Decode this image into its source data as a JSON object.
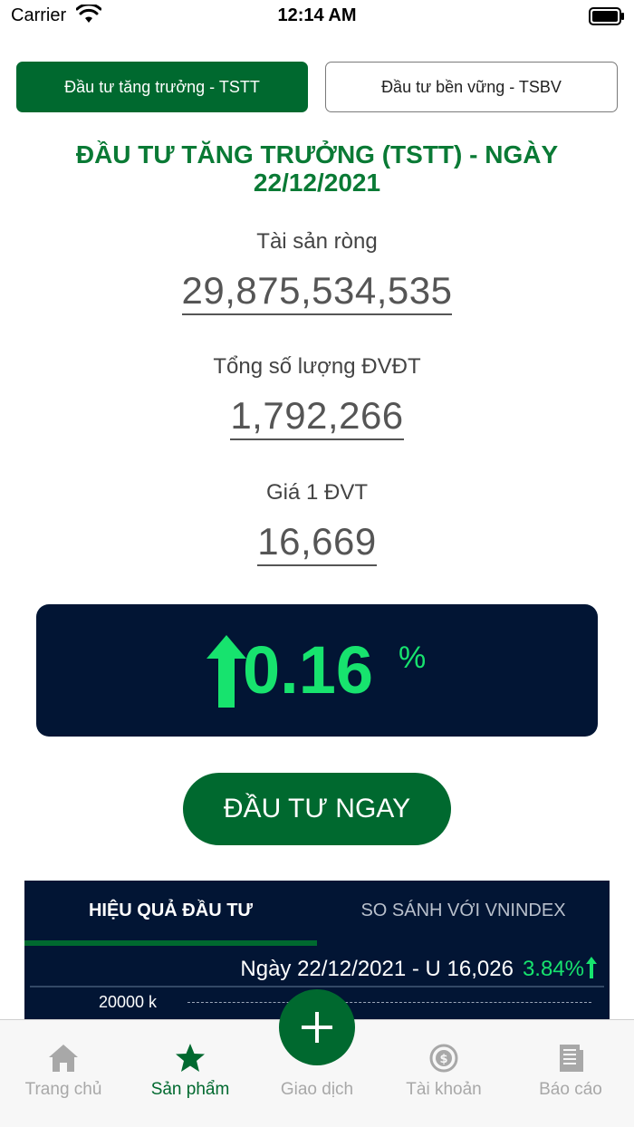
{
  "status_bar": {
    "carrier": "Carrier",
    "time": "12:14 AM"
  },
  "segment": {
    "tstt_label": "Đầu tư tăng trưởng - TSTT",
    "tsbv_label": "Đầu tư bền vững - TSBV",
    "active": "tstt"
  },
  "title": {
    "line1": "ĐẦU TƯ TĂNG TRƯỞNG (TSTT) - NGÀY",
    "line2": "22/12/2021"
  },
  "metrics": [
    {
      "label": "Tài sản ròng",
      "value": "29,875,534,535"
    },
    {
      "label": "Tổng số lượng ĐVĐT",
      "value": "1,792,266"
    },
    {
      "label": "Giá 1 ĐVT",
      "value": "16,669"
    }
  ],
  "performance": {
    "value": "0.16",
    "unit": "%",
    "direction": "up",
    "color": "#17e36e"
  },
  "invest_button": {
    "label": "ĐẦU TƯ NGAY"
  },
  "chart_panel": {
    "tabs": [
      {
        "label": "HIỆU QUẢ ĐẦU TƯ",
        "active": true
      },
      {
        "label": "SO SÁNH VỚI VNINDEX",
        "active": false
      }
    ],
    "date_label": "Ngày 22/12/2021 - U 16,026",
    "change": "3.84%",
    "y_tick": "20000 k"
  },
  "tabbar": {
    "items": [
      {
        "label": "Trang chủ",
        "icon": "home-icon",
        "active": false
      },
      {
        "label": "Sản phẩm",
        "icon": "star-icon",
        "active": true
      },
      {
        "label": "Giao dịch",
        "icon": "plus-icon",
        "active": false
      },
      {
        "label": "Tài khoản",
        "icon": "coin-icon",
        "active": false
      },
      {
        "label": "Báo cáo",
        "icon": "report-icon",
        "active": false
      }
    ]
  },
  "colors": {
    "brand_green": "#00692f",
    "navy": "#021534",
    "up_green": "#17e36e",
    "title_green": "#0a7a35"
  }
}
